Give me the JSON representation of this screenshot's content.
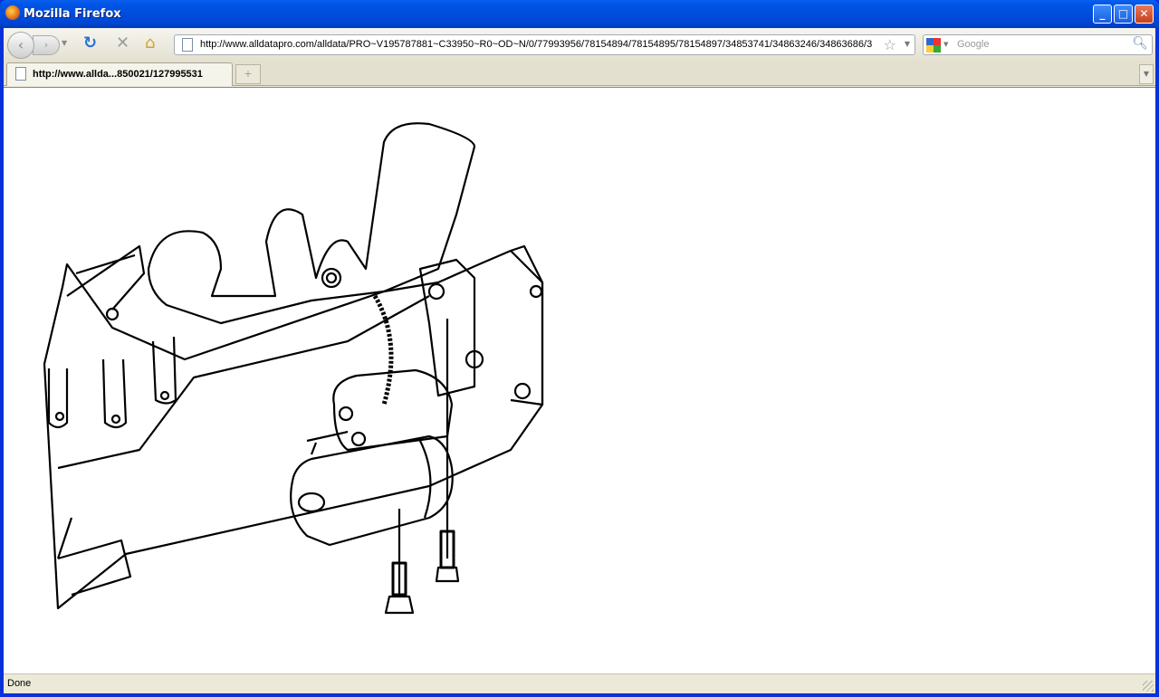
{
  "window": {
    "title": "Mozilla Firefox"
  },
  "toolbar": {
    "url": "http://www.alldatapro.com/alldata/PRO~V195787881~C33950~R0~OD~N/0/77993956/78154894/78154895/78154897/34853741/34863246/34863686/3",
    "search_placeholder": "Google"
  },
  "tabs": [
    {
      "label": "http://www.allda...850021/127995531",
      "active": true
    }
  ],
  "content": {
    "image": "starter motor mounting diagram"
  },
  "status": {
    "text": "Done"
  }
}
